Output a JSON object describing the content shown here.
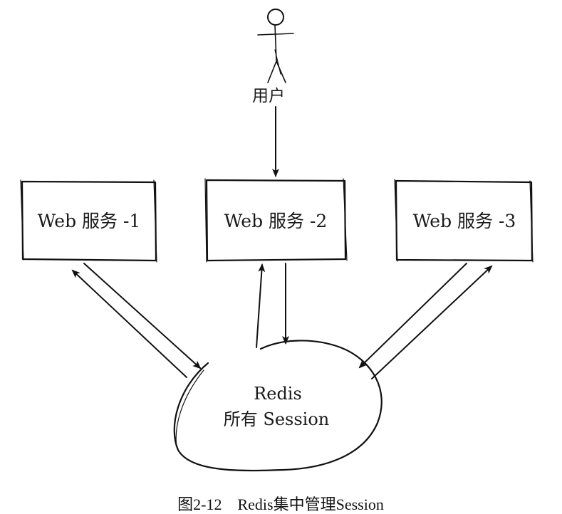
{
  "actor": {
    "label": "用户",
    "icon": "stick-figure-user-icon"
  },
  "services": [
    {
      "label": "Web 服务 -1"
    },
    {
      "label": "Web 服务 -2"
    },
    {
      "label": "Web 服务 -3"
    }
  ],
  "store": {
    "line1": "Redis",
    "line2": "所有 Session"
  },
  "caption": "图2-12　Redis集中管理Session",
  "colors": {
    "ink": "#111111",
    "background": "#ffffff"
  }
}
